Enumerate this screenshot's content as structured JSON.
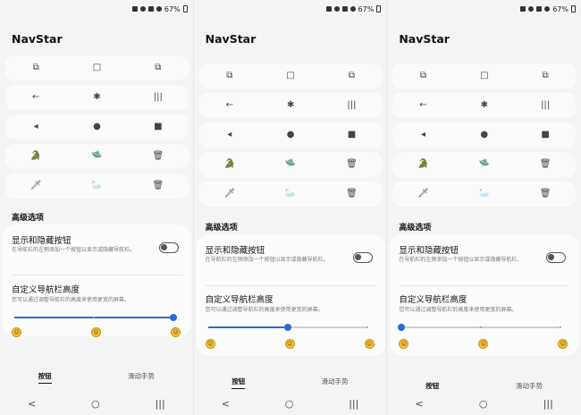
{
  "status_bar": {
    "battery": "67%"
  },
  "app": {
    "title": "NavStar"
  },
  "button_rows": [
    [
      "⧉",
      "□",
      "⧉"
    ],
    [
      "←",
      "✱",
      "|||"
    ],
    [
      "◂",
      "●",
      "■"
    ],
    [
      "🐊",
      "🛸",
      "🗑"
    ],
    [
      "🗡",
      "🦢",
      "🗑"
    ]
  ],
  "advanced": {
    "label": "高级选项",
    "toggle_title": "显示和隐藏按钮",
    "toggle_desc": "在导航栏的左侧添加一个按钮以显示或隐藏导航栏。",
    "height_title": "自定义导航栏高度",
    "height_desc": "您可以通过调整导航栏的高度来使用更宽的屏幕。"
  },
  "tabs": {
    "buttons": "按钮",
    "gestures": "滑动手势"
  },
  "nav_bar": {
    "back": "<",
    "home": "○",
    "recents": "|||"
  },
  "screens": [
    {
      "toggle_on": false,
      "slider_percent": 100
    },
    {
      "toggle_on": false,
      "slider_percent": 50
    },
    {
      "toggle_on": false,
      "slider_percent": 0
    }
  ],
  "colors": {
    "accent": "#2d6bd3",
    "background": "#f4f4f4",
    "card": "#fcfcfc"
  }
}
